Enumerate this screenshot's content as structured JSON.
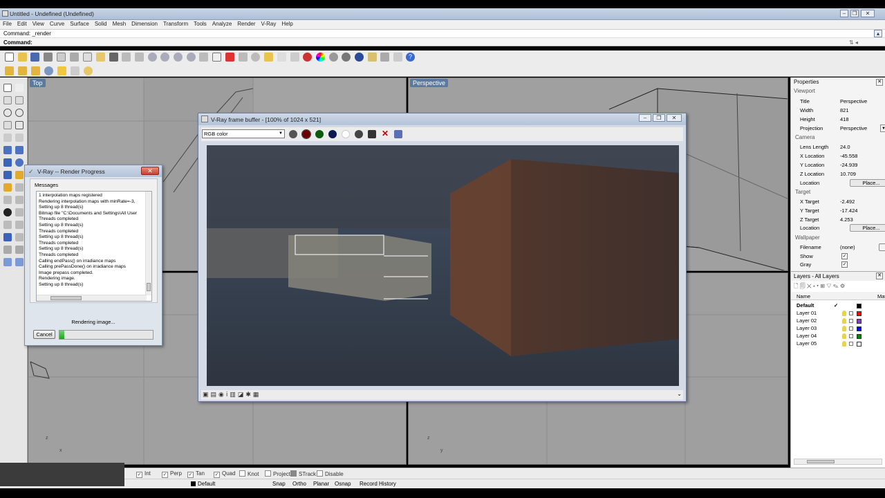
{
  "window": {
    "title": "Untitled - Undefined (Undefined)"
  },
  "menu": [
    "File",
    "Edit",
    "View",
    "Curve",
    "Surface",
    "Solid",
    "Mesh",
    "Dimension",
    "Transform",
    "Tools",
    "Analyze",
    "Render",
    "V-Ray",
    "Help"
  ],
  "command": {
    "history": "Command: _render",
    "prompt": "Command:"
  },
  "viewports": {
    "top": "Top",
    "perspective": "Perspective"
  },
  "properties": {
    "title": "Properties",
    "viewport_section": "Viewport",
    "viewport": [
      {
        "k": "Title",
        "v": "Perspective"
      },
      {
        "k": "Width",
        "v": "821"
      },
      {
        "k": "Height",
        "v": "418"
      },
      {
        "k": "Projection",
        "v": "Perspective"
      }
    ],
    "camera_section": "Camera",
    "camera": [
      {
        "k": "Lens Length",
        "v": "24.0"
      },
      {
        "k": "X Location",
        "v": "-45.558"
      },
      {
        "k": "Y Location",
        "v": "-24.939"
      },
      {
        "k": "Z Location",
        "v": "10.709"
      }
    ],
    "camera_location_label": "Location",
    "place_label": "Place...",
    "target_section": "Target",
    "target": [
      {
        "k": "X Target",
        "v": "-2.492"
      },
      {
        "k": "Y Target",
        "v": "-17.424"
      },
      {
        "k": "Z Target",
        "v": "4.253"
      }
    ],
    "target_location_label": "Location",
    "wallpaper_section": "Wallpaper",
    "wallpaper": {
      "filename_label": "Filename",
      "filename": "(none)",
      "show_label": "Show",
      "gray_label": "Gray"
    }
  },
  "layers": {
    "title": "Layers - All Layers",
    "col_name": "Name",
    "col_mat": "Mate",
    "rows": [
      {
        "name": "Default",
        "color": "#000000"
      },
      {
        "name": "Layer 01",
        "color": "#ff0000"
      },
      {
        "name": "Layer 02",
        "color": "#8040c0"
      },
      {
        "name": "Layer 03",
        "color": "#0000ff"
      },
      {
        "name": "Layer 04",
        "color": "#008000"
      },
      {
        "name": "Layer 05",
        "color": "#ffffff"
      }
    ]
  },
  "frame_buffer": {
    "title": "V-Ray frame buffer - [100% of 1024 x 521]",
    "channel": "RGB color"
  },
  "render_progress": {
    "title": "V-Ray -- Render Progress",
    "messages_label": "Messages",
    "messages": [
      "1 interpolation maps registered",
      "Rendering interpolation maps with minRate=-3,",
      "Setting up 8 thread(s)",
      "Bitmap file \"C:\\Documents and Settings\\All User",
      "Threads completed",
      "Setting up 8 thread(s)",
      "Threads completed",
      "Setting up 8 thread(s)",
      "Threads completed",
      "Setting up 8 thread(s)",
      "Threads completed",
      "Calling endPass() on irradiance maps",
      "Calling prePassDone() on irradiance maps",
      "Image prepass completed.",
      "Rendering image.",
      "Setting up 8 thread(s)"
    ],
    "status": "Rendering image...",
    "cancel": "Cancel",
    "progress": 0.05
  },
  "osnap": [
    {
      "label": "Int",
      "on": true
    },
    {
      "label": "Perp",
      "on": true
    },
    {
      "label": "Tan",
      "on": true
    },
    {
      "label": "Quad",
      "on": true
    },
    {
      "label": "Knot",
      "on": false
    },
    {
      "label": "Project",
      "on": false
    },
    {
      "label": "STrack",
      "on": false
    },
    {
      "label": "Disable",
      "on": false
    }
  ],
  "statusbar": {
    "layer": "Default",
    "snap": "Snap",
    "ortho": "Ortho",
    "planar": "Planar",
    "osnap": "Osnap",
    "record": "Record History"
  }
}
